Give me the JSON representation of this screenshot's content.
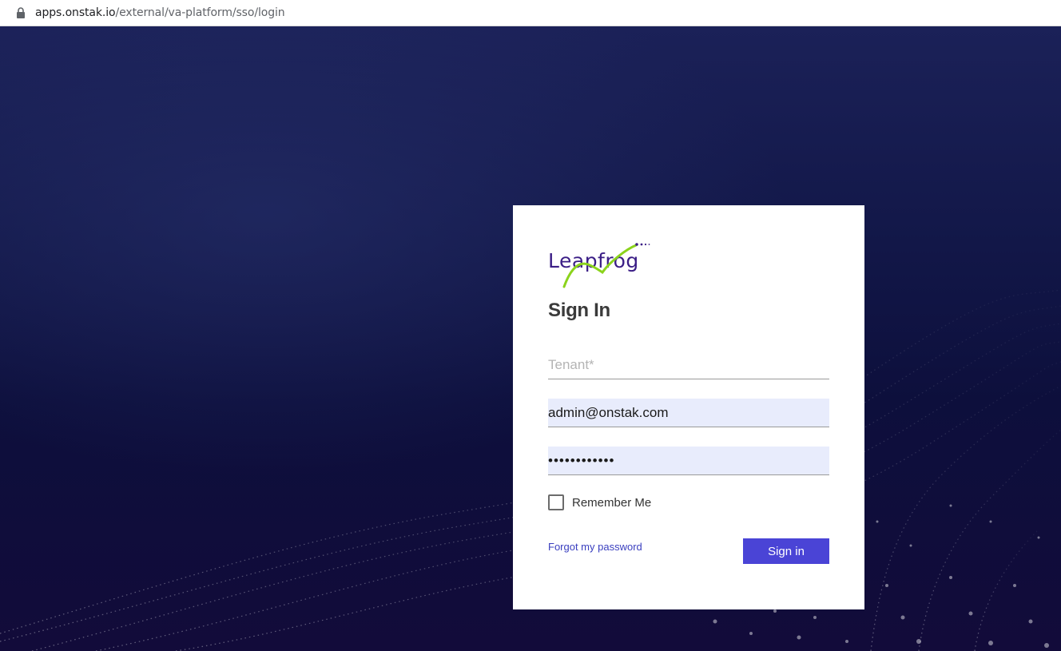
{
  "browser": {
    "url_host": "apps.onstak.io",
    "url_path": "/external/va-platform/sso/login"
  },
  "logo": {
    "text": "Leapfrog",
    "icon": "leapfrog-logo"
  },
  "form": {
    "title": "Sign In",
    "tenant_placeholder": "Tenant*",
    "tenant_value": "",
    "email_value": "admin@onstak.com",
    "password_value": "••••••••••••",
    "remember_label": "Remember Me",
    "remember_checked": false,
    "forgot_label": "Forgot my password",
    "signin_label": "Sign in"
  },
  "colors": {
    "accent": "#4a44d6",
    "autofill_bg": "#e8ecfc",
    "background": "#0b0f3a",
    "logo_purple": "#3b1e86",
    "logo_green": "#8bd31c"
  }
}
